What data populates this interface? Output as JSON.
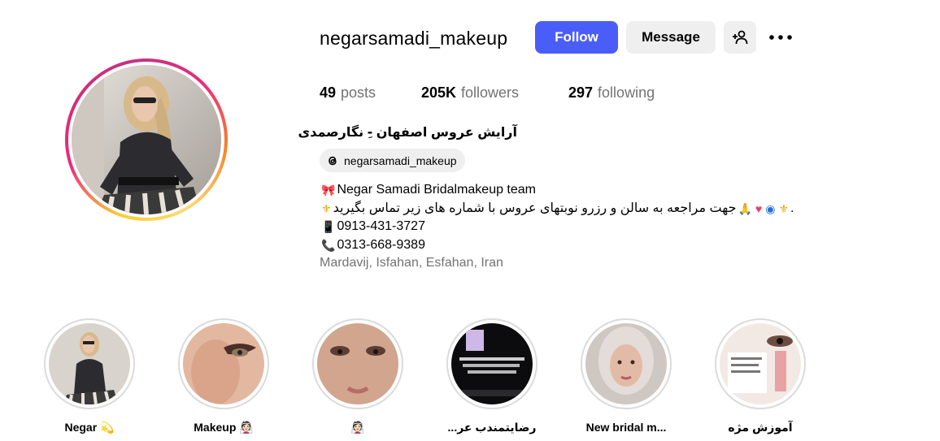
{
  "profile": {
    "username": "negarsamadi_makeup",
    "full_name": "آرایش عروس اصفهان -ِ نگارصمدی",
    "threads_handle": "negarsamadi_makeup"
  },
  "actions": {
    "follow_label": "Follow",
    "message_label": "Message",
    "add_user_icon": "person-add-icon",
    "more_icon": "ellipsis-icon",
    "more_label": "•••"
  },
  "stats": {
    "posts_count": "49",
    "posts_label": "posts",
    "followers_count": "205K",
    "followers_label": "followers",
    "following_count": "297",
    "following_label": "following"
  },
  "bio": {
    "line1": "Negar Samadi Bridalmakeup team",
    "line2": "جهت مراجعه به سالن و رزرو نوبتهای عروس با شماره های زیر تماس بگیرید",
    "line2_suffix": ".",
    "phone1": "0913-431-3727",
    "phone2": "0313-668-9389",
    "location": "Mardavij, Isfahan, Esfahan, Iran"
  },
  "highlights": [
    {
      "label": "Negar 💫"
    },
    {
      "label": "Makeup 👰🏻"
    },
    {
      "label": "👰🏻"
    },
    {
      "label": "رضایتمندب عر..."
    },
    {
      "label": "New bridal m..."
    },
    {
      "label": "آموزش مژه"
    }
  ],
  "colors": {
    "accent": "#4a5df9",
    "secondary_button": "#efefef",
    "muted_text": "#737373"
  }
}
